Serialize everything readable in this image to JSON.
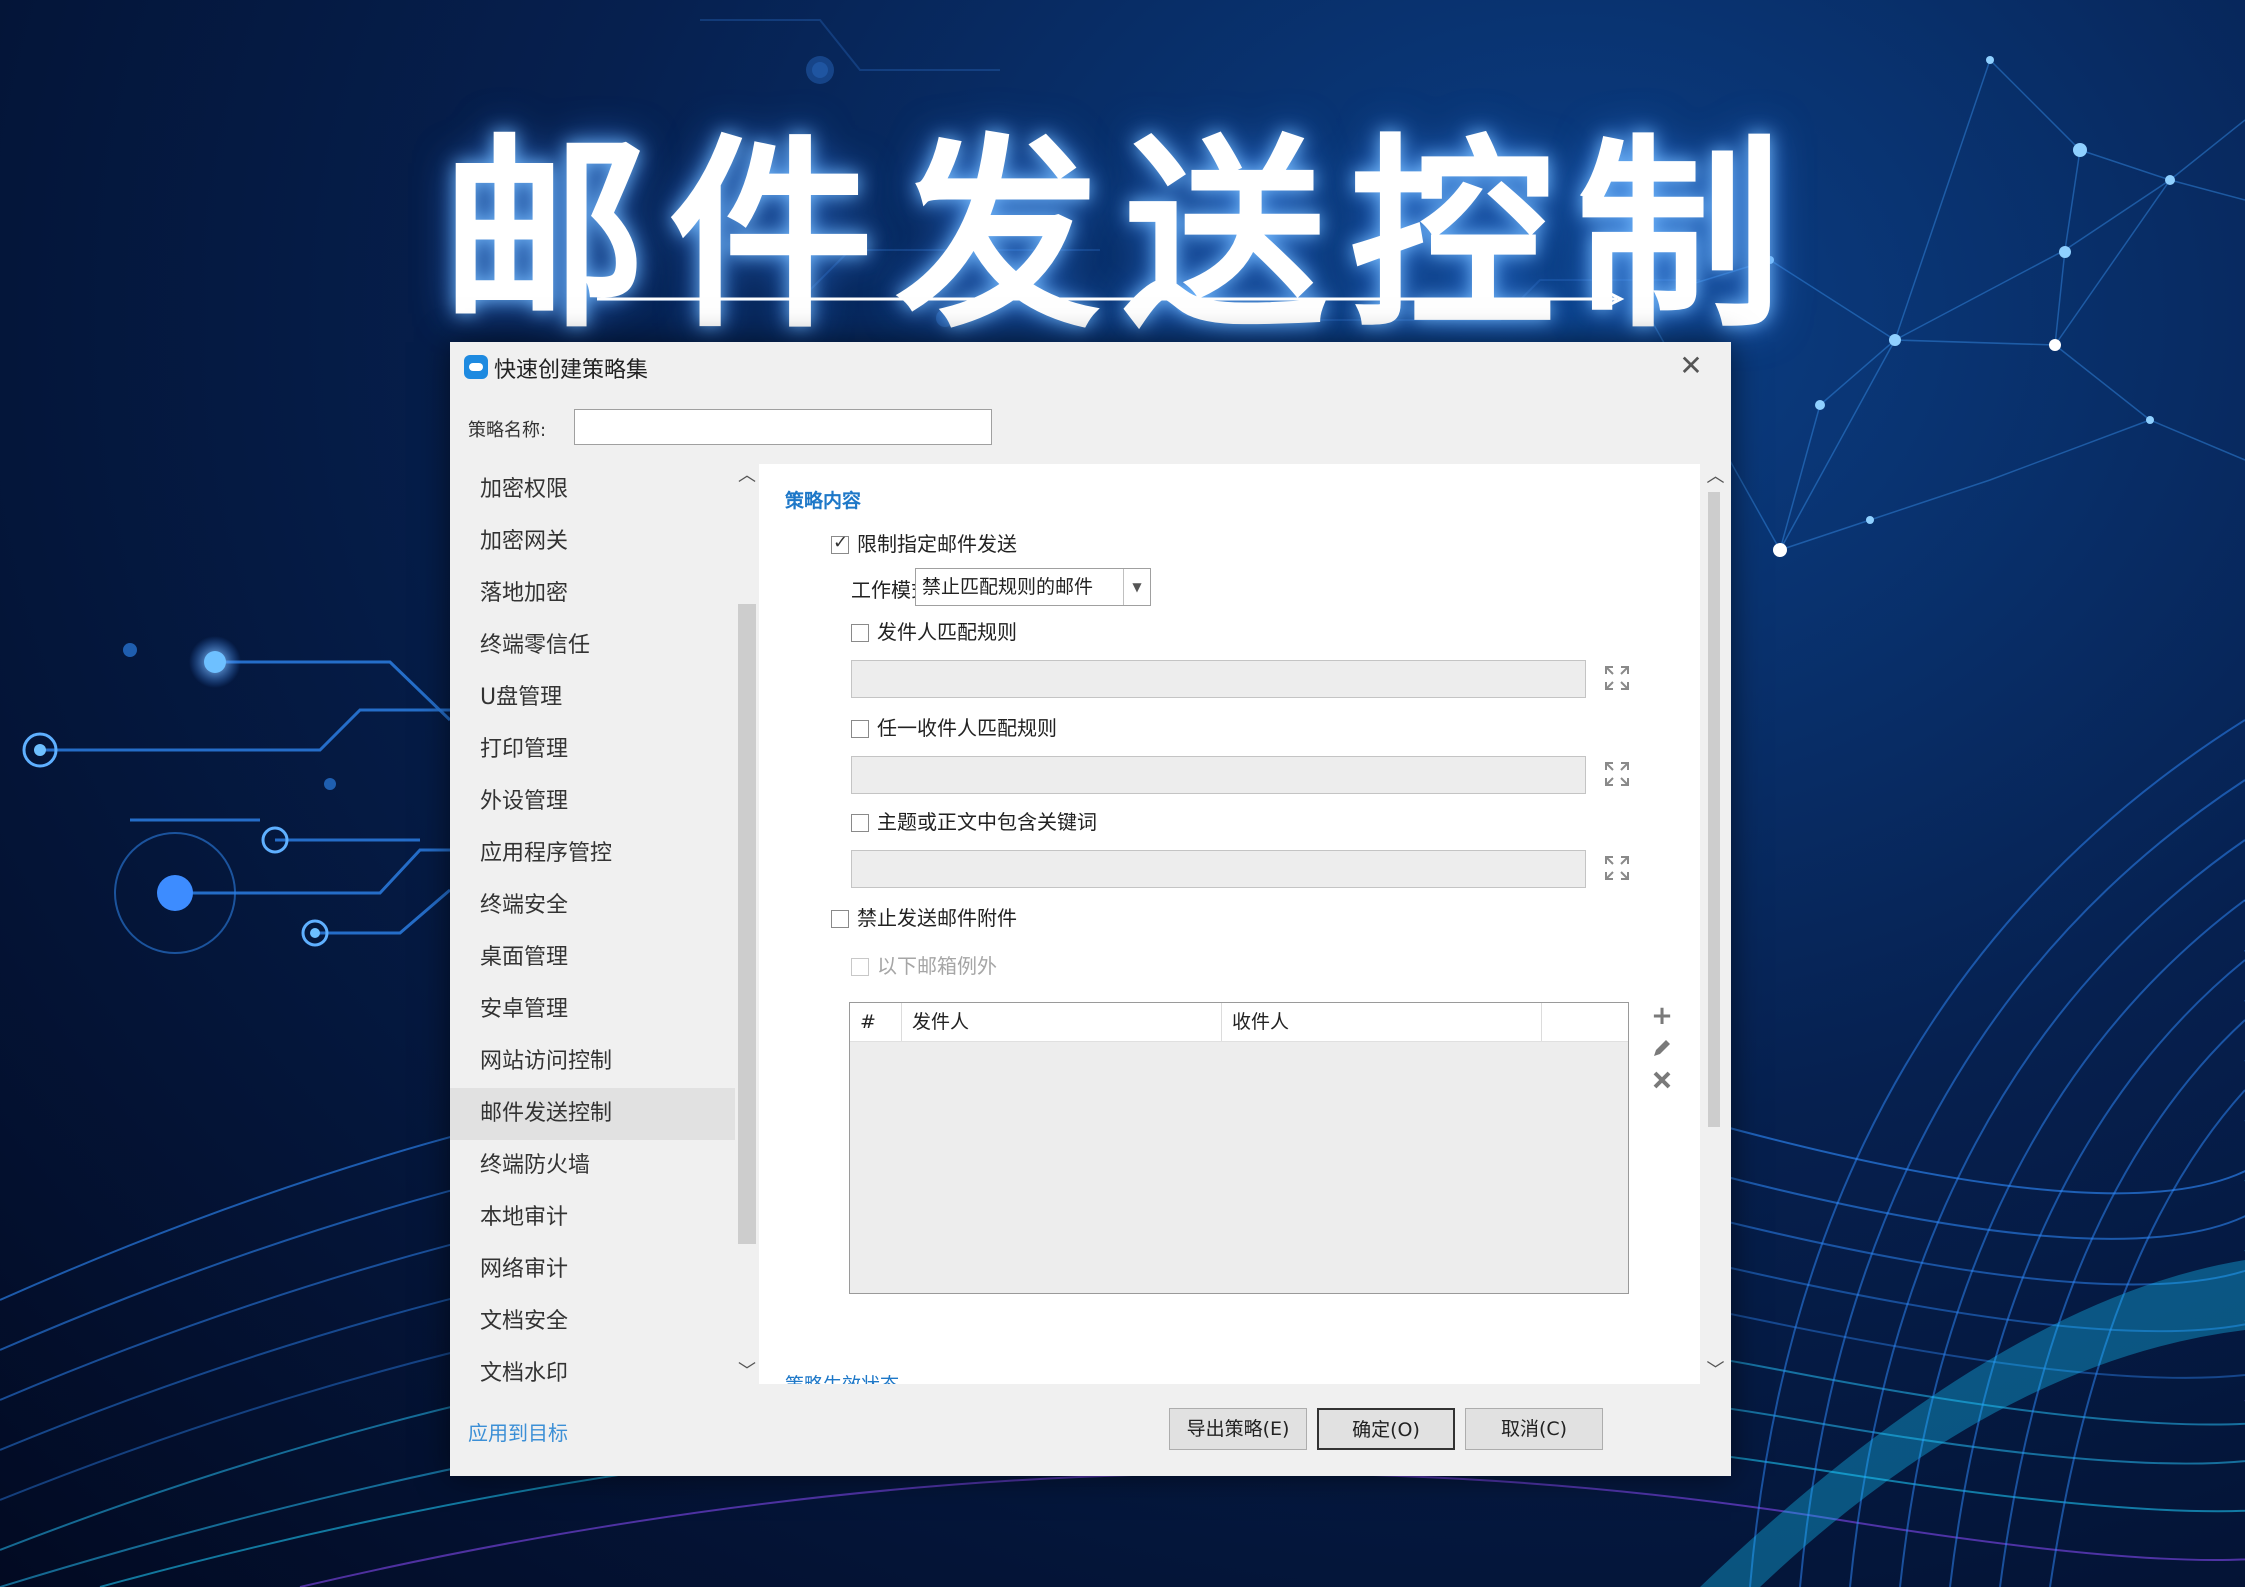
{
  "hero": {
    "title": "邮件发送控制"
  },
  "dialog": {
    "title": "快速创建策略集",
    "policy_name_label": "策略名称:",
    "policy_name_value": "",
    "sidebar": {
      "items": [
        {
          "label": "加密权限"
        },
        {
          "label": "加密网关"
        },
        {
          "label": "落地加密"
        },
        {
          "label": "终端零信任"
        },
        {
          "label": "U盘管理"
        },
        {
          "label": "打印管理"
        },
        {
          "label": "外设管理"
        },
        {
          "label": "应用程序管控"
        },
        {
          "label": "终端安全"
        },
        {
          "label": "桌面管理"
        },
        {
          "label": "安卓管理"
        },
        {
          "label": "网站访问控制"
        },
        {
          "label": "邮件发送控制"
        },
        {
          "label": "终端防火墙"
        },
        {
          "label": "本地审计"
        },
        {
          "label": "网络审计"
        },
        {
          "label": "文档安全"
        },
        {
          "label": "文档水印"
        }
      ],
      "active_item": "邮件发送控制"
    },
    "content": {
      "section_title": "策略内容",
      "restrict_send": {
        "label": "限制指定邮件发送",
        "checked": true
      },
      "work_mode": {
        "label": "工作模式",
        "value": "禁止匹配规则的邮件"
      },
      "sender_rule": {
        "label": "发件人匹配规则",
        "checked": false,
        "value": ""
      },
      "recipient_rule": {
        "label": "任一收件人匹配规则",
        "checked": false,
        "value": ""
      },
      "keyword_rule": {
        "label": "主题或正文中包含关键词",
        "checked": false,
        "value": ""
      },
      "block_attachment": {
        "label": "禁止发送邮件附件",
        "checked": false
      },
      "except_mailbox": {
        "label": "以下邮箱例外",
        "checked": false,
        "enabled": false
      },
      "table": {
        "columns": [
          "#",
          "发件人",
          "收件人",
          ""
        ],
        "rows": []
      },
      "next_section_title": "策略生效状态"
    },
    "footer": {
      "apply_link": "应用到目标",
      "export_button": "导出策略(E)",
      "ok_button": "确定(O)",
      "cancel_button": "取消(C)"
    }
  },
  "colors": {
    "accent_link": "#3b8fd6",
    "section_title": "#1e78c8",
    "background_deep": "#020a22",
    "background_glow": "#0b3f86"
  }
}
